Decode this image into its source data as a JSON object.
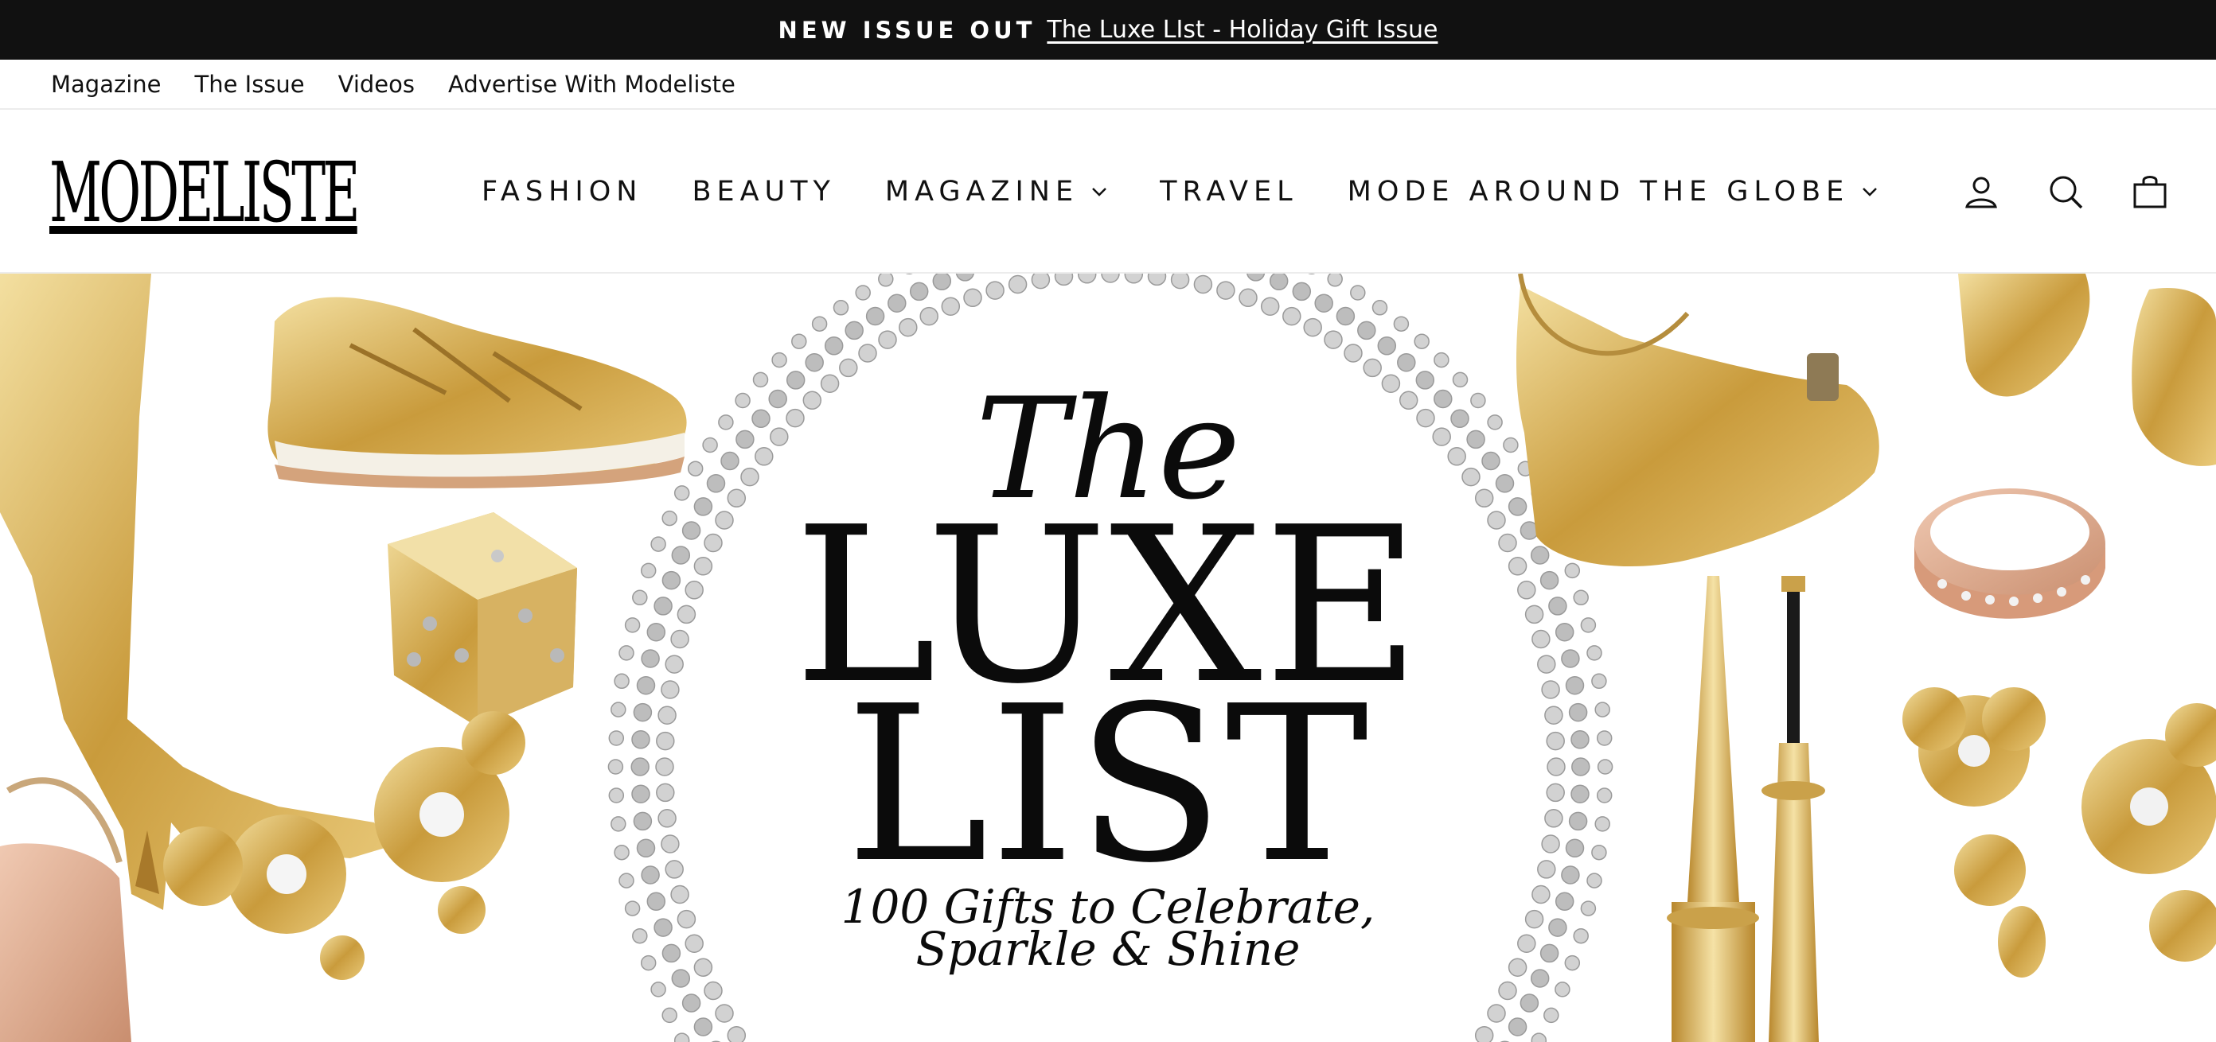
{
  "announcement": {
    "kicker": "NEW ISSUE OUT",
    "link_text": "The Luxe LIst - Holiday Gift Issue"
  },
  "utility_nav": [
    {
      "label": "Magazine"
    },
    {
      "label": "The Issue"
    },
    {
      "label": "Videos"
    },
    {
      "label": "Advertise With Modeliste"
    }
  ],
  "header": {
    "logo": "MODELISTE",
    "nav": [
      {
        "label": "FASHION",
        "dropdown": false
      },
      {
        "label": "BEAUTY",
        "dropdown": false
      },
      {
        "label": "MAGAZINE",
        "dropdown": true
      },
      {
        "label": "TRAVEL",
        "dropdown": false
      },
      {
        "label": "MODE AROUND THE GLOBE",
        "dropdown": true
      }
    ],
    "icons": [
      "account-icon",
      "search-icon",
      "cart-icon"
    ]
  },
  "hero": {
    "line1": "The",
    "line2": "LUXE",
    "line3": "LIST",
    "subtitle1": "100 Gifts to Celebrate,",
    "subtitle2": "Sparkle & Shine"
  },
  "colors": {
    "announcement_bg": "#111111",
    "gold": "#d4ad55",
    "silver": "#c9c9c9",
    "rose_gold": "#d9a98f"
  }
}
